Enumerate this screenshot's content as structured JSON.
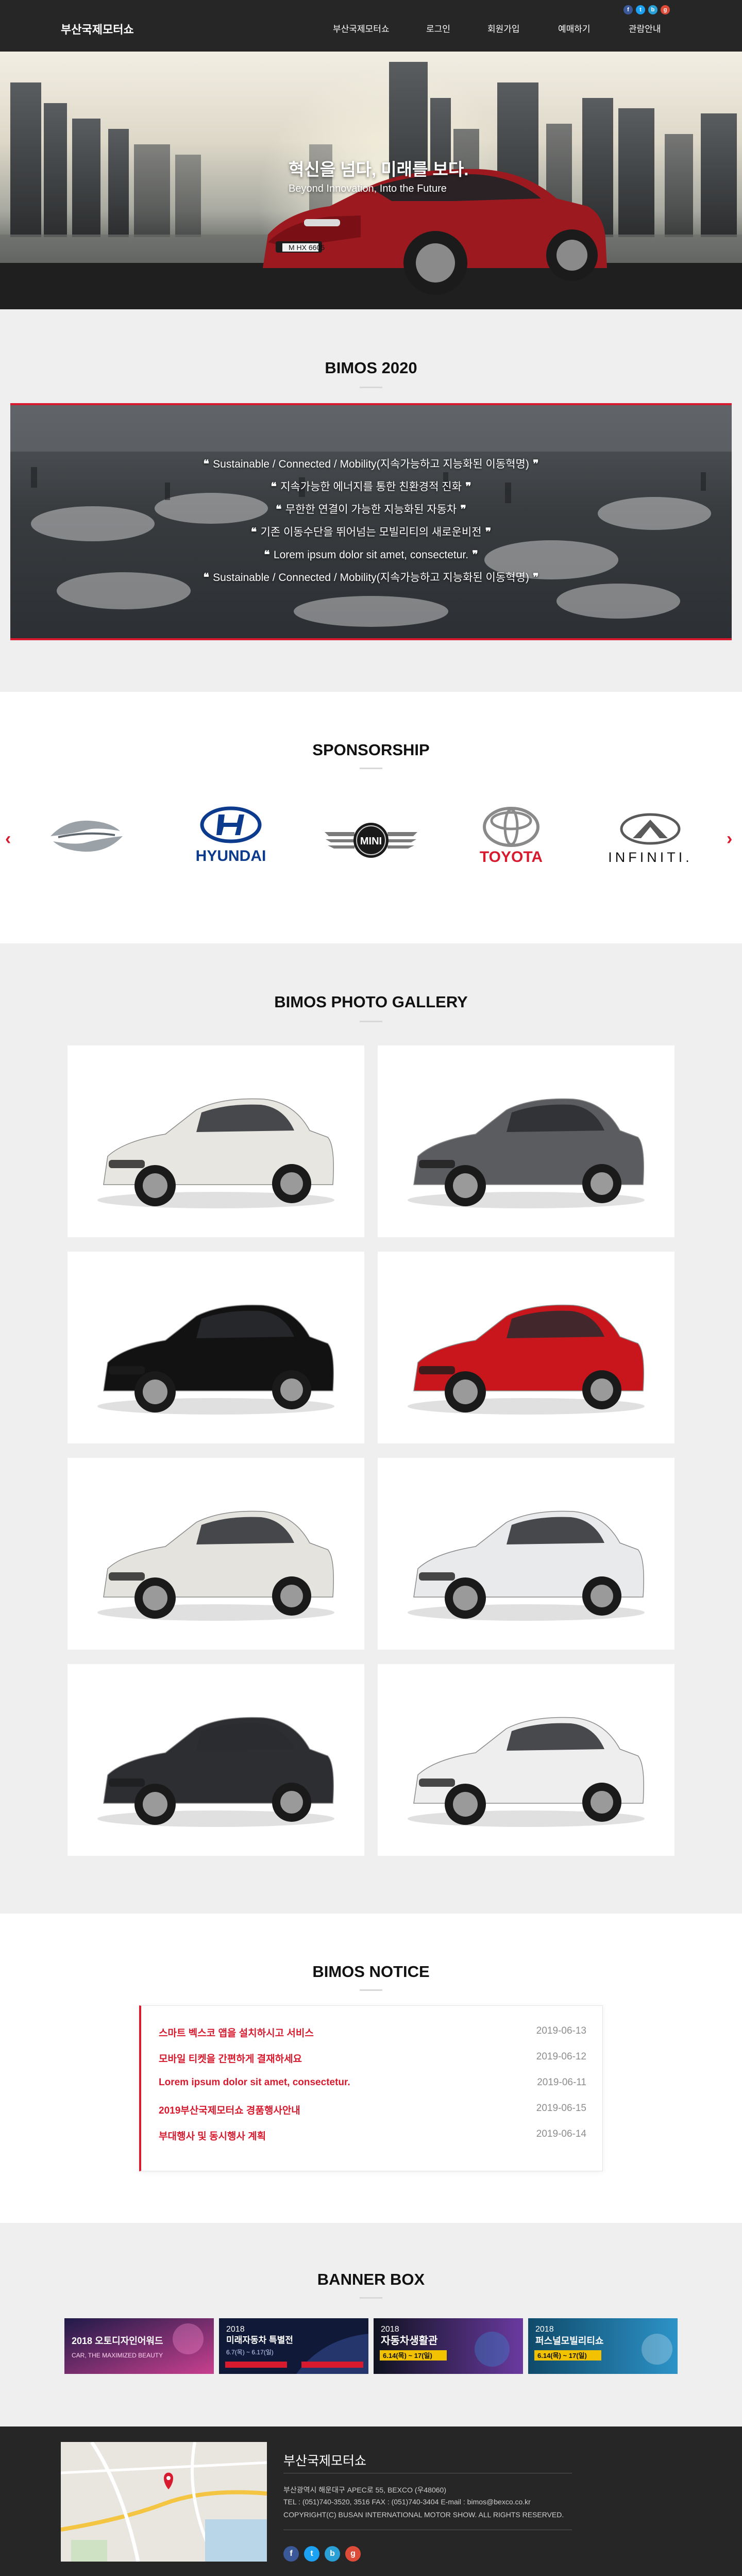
{
  "header": {
    "logo": "부산국제모터쇼",
    "social": [
      "f",
      "t",
      "b",
      "g"
    ],
    "nav": [
      "부산국제모터쇼",
      "로그인",
      "회원가입",
      "예매하기",
      "관람안내"
    ]
  },
  "hero": {
    "title": "혁신을 넘다, 미래를 보다.",
    "subtitle": "Beyond Innovation, Into the Future",
    "plate": "M HX 6605"
  },
  "bimos": {
    "title": "BIMOS 2020",
    "lines": [
      "Sustainable / Connected / Mobility(지속가능하고 지능화된 이동혁명)",
      "지속가능한 에너지를 통한 친환경적 진화",
      "무한한 연결이 가능한 지능화된 자동차",
      "기존 이동수단을 뛰어넘는 모빌리티의 새로운비전",
      "Lorem ipsum dolor sit amet, consectetur.",
      "Sustainable / Connected / Mobility(지속가능하고 지능화된 이동혁명)"
    ]
  },
  "sponsorship": {
    "title": "SPONSORSHIP",
    "prev_icon": "chevron-left-icon",
    "next_icon": "chevron-right-icon",
    "brands": [
      "",
      "HYUNDAI",
      "MINI",
      "TOYOTA",
      "INFINITI."
    ]
  },
  "gallery": {
    "title": "BIMOS PHOTO GALLERY",
    "items": [
      {
        "color": "#e8e6e1"
      },
      {
        "color": "#5a5c60"
      },
      {
        "color": "#121212"
      },
      {
        "color": "#c9161c"
      },
      {
        "color": "#e4e3de"
      },
      {
        "color": "#e9eaec"
      },
      {
        "color": "#2c2e32"
      },
      {
        "color": "#eeeeee"
      }
    ]
  },
  "notice": {
    "title": "BIMOS NOTICE",
    "items": [
      {
        "title": "스마트 벡스코 앱을 설치하시고 서비스",
        "date": "2019-06-13"
      },
      {
        "title": "모바일 티켓을 간편하게 결재하세요",
        "date": "2019-06-12"
      },
      {
        "title": "Lorem ipsum dolor sit amet, consectetur.",
        "date": "2019-06-11"
      },
      {
        "title": "2019부산국제모터쇼 경품행사안내",
        "date": "2019-06-15"
      },
      {
        "title": "부대행사 및 동시행사 계획",
        "date": "2019-06-14"
      }
    ]
  },
  "banner": {
    "title": "BANNER BOX",
    "items": [
      {
        "top": "2018 오토디자인어워드",
        "main": "CAR, THE MAXIMIZED BEAUTY",
        "color": "#1f1a48"
      },
      {
        "top": "2018",
        "main": "미래자동차 특별전",
        "sub": "6.7(목) ~ 6.17(일)",
        "color": "#101a38"
      },
      {
        "top": "2018",
        "main": "자동차생활관",
        "sub": "6.14(목) ~ 17(일)",
        "color": "#0f1220"
      },
      {
        "top": "2018",
        "main": "퍼스널모빌리티쇼",
        "sub": "6.14(목) ~ 17(일)",
        "color": "#0f4a6a"
      }
    ]
  },
  "footer": {
    "title": "부산국제모터쇼",
    "address": "부산광역시 해운대구 APEC로 55, BEXCO (우48060)",
    "contact": "TEL : (051)740-3520, 3516 FAX : (051)740-3404 E-mail : bimos@bexco.co.kr",
    "copyright": "COPYRIGHT(C) BUSAN INTERNATIONAL MOTOR SHOW. ALL RIGHTS RESERVED.",
    "social": [
      "f",
      "t",
      "b",
      "g"
    ]
  }
}
